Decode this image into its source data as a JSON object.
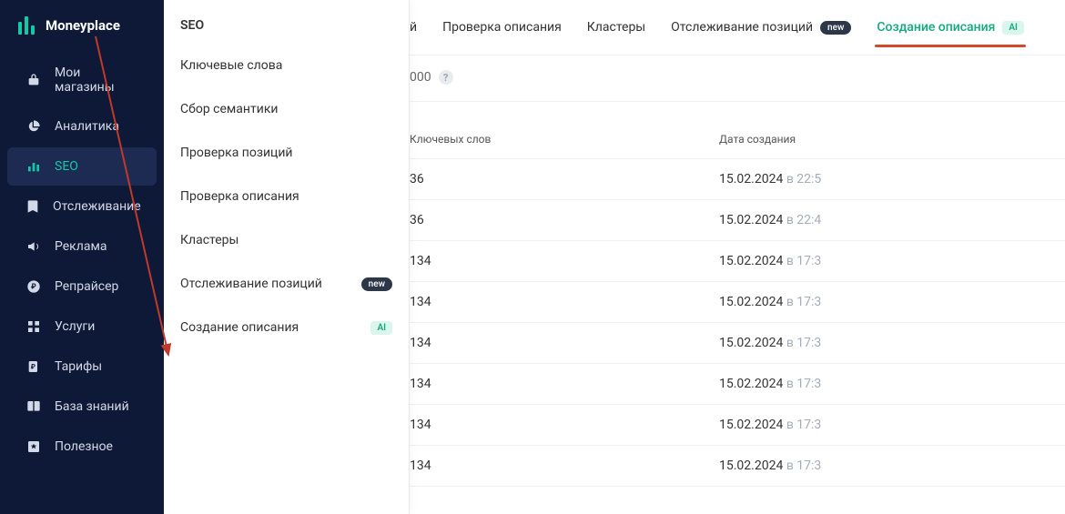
{
  "brand": "Moneyplace",
  "sidebar": {
    "items": [
      {
        "label": "Мои магазины"
      },
      {
        "label": "Аналитика"
      },
      {
        "label": "SEO"
      },
      {
        "label": "Отслеживание"
      },
      {
        "label": "Реклама"
      },
      {
        "label": "Репрайсер"
      },
      {
        "label": "Услуги"
      },
      {
        "label": "Тарифы"
      },
      {
        "label": "База знаний"
      },
      {
        "label": "Полезное"
      }
    ]
  },
  "submenu": {
    "title": "SEO",
    "items": [
      {
        "label": "Ключевые слова"
      },
      {
        "label": "Сбор семантики"
      },
      {
        "label": "Проверка позиций"
      },
      {
        "label": "Проверка описания"
      },
      {
        "label": "Кластеры"
      },
      {
        "label": "Отслеживание позиций",
        "badge": "new"
      },
      {
        "label": "Создание описания",
        "badge": "AI"
      }
    ]
  },
  "tabs": [
    {
      "label": "й"
    },
    {
      "label": "Проверка описания"
    },
    {
      "label": "Кластеры"
    },
    {
      "label": "Отслеживание позиций",
      "badge": "new"
    },
    {
      "label": "Создание описания",
      "badge": "AI",
      "active": true
    }
  ],
  "input_suffix": "000",
  "table": {
    "headers": {
      "kw": "Ключевых слов",
      "date": "Дата создания"
    },
    "rows": [
      {
        "kw": "36",
        "date": "15.02.2024",
        "time": "в 22:5"
      },
      {
        "kw": "36",
        "date": "15.02.2024",
        "time": "в 22:4"
      },
      {
        "kw": "134",
        "date": "15.02.2024",
        "time": "в 17:3"
      },
      {
        "kw": "134",
        "date": "15.02.2024",
        "time": "в 17:3"
      },
      {
        "kw": "134",
        "date": "15.02.2024",
        "time": "в 17:3"
      },
      {
        "kw": "134",
        "date": "15.02.2024",
        "time": "в 17:3"
      },
      {
        "kw": "134",
        "date": "15.02.2024",
        "time": "в 17:3"
      },
      {
        "kw": "134",
        "date": "15.02.2024",
        "time": "в 17:3"
      }
    ]
  },
  "badge_labels": {
    "new": "new",
    "ai": "AI"
  }
}
